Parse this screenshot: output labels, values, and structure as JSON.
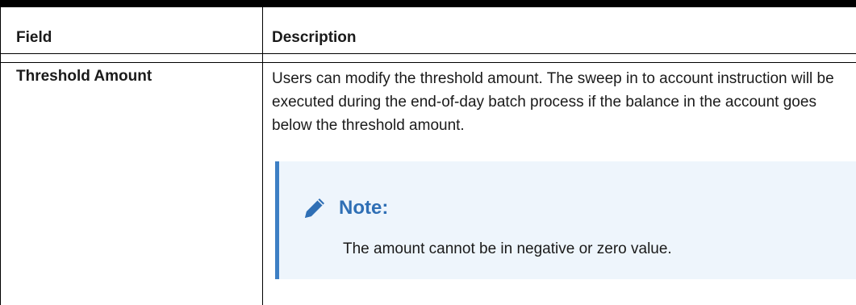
{
  "table": {
    "headers": {
      "field": "Field",
      "description": "Description"
    },
    "rows": [
      {
        "field": "Threshold Amount",
        "description": "Users can modify the threshold amount. The sweep in to account instruction will be executed during the end-of-day batch process if the balance in the account goes below the threshold amount.",
        "note": {
          "icon": "pencil-icon",
          "title": "Note:",
          "body": "The amount cannot be in negative or zero value."
        }
      }
    ]
  },
  "colors": {
    "note_background": "#eef5fc",
    "note_accent": "#3d7fc4",
    "note_title": "#2f6fb5"
  }
}
